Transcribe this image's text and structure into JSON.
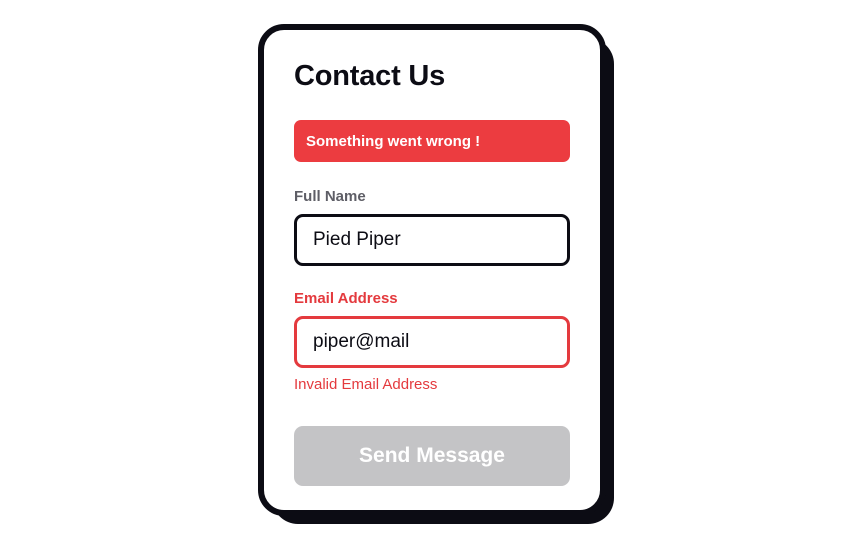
{
  "form": {
    "title": "Contact Us",
    "alert_message": "Something went wrong !",
    "full_name": {
      "label": "Full Name",
      "value": "Pied Piper"
    },
    "email": {
      "label": "Email Address",
      "value": "piper@mail",
      "error": "Invalid Email Address"
    },
    "submit_label": "Send Message",
    "submit_disabled": true
  },
  "colors": {
    "card_border": "#0c0c14",
    "error_red": "#ec3c40",
    "disabled_button": "#c4c4c6",
    "muted_label": "#5e5e66"
  }
}
